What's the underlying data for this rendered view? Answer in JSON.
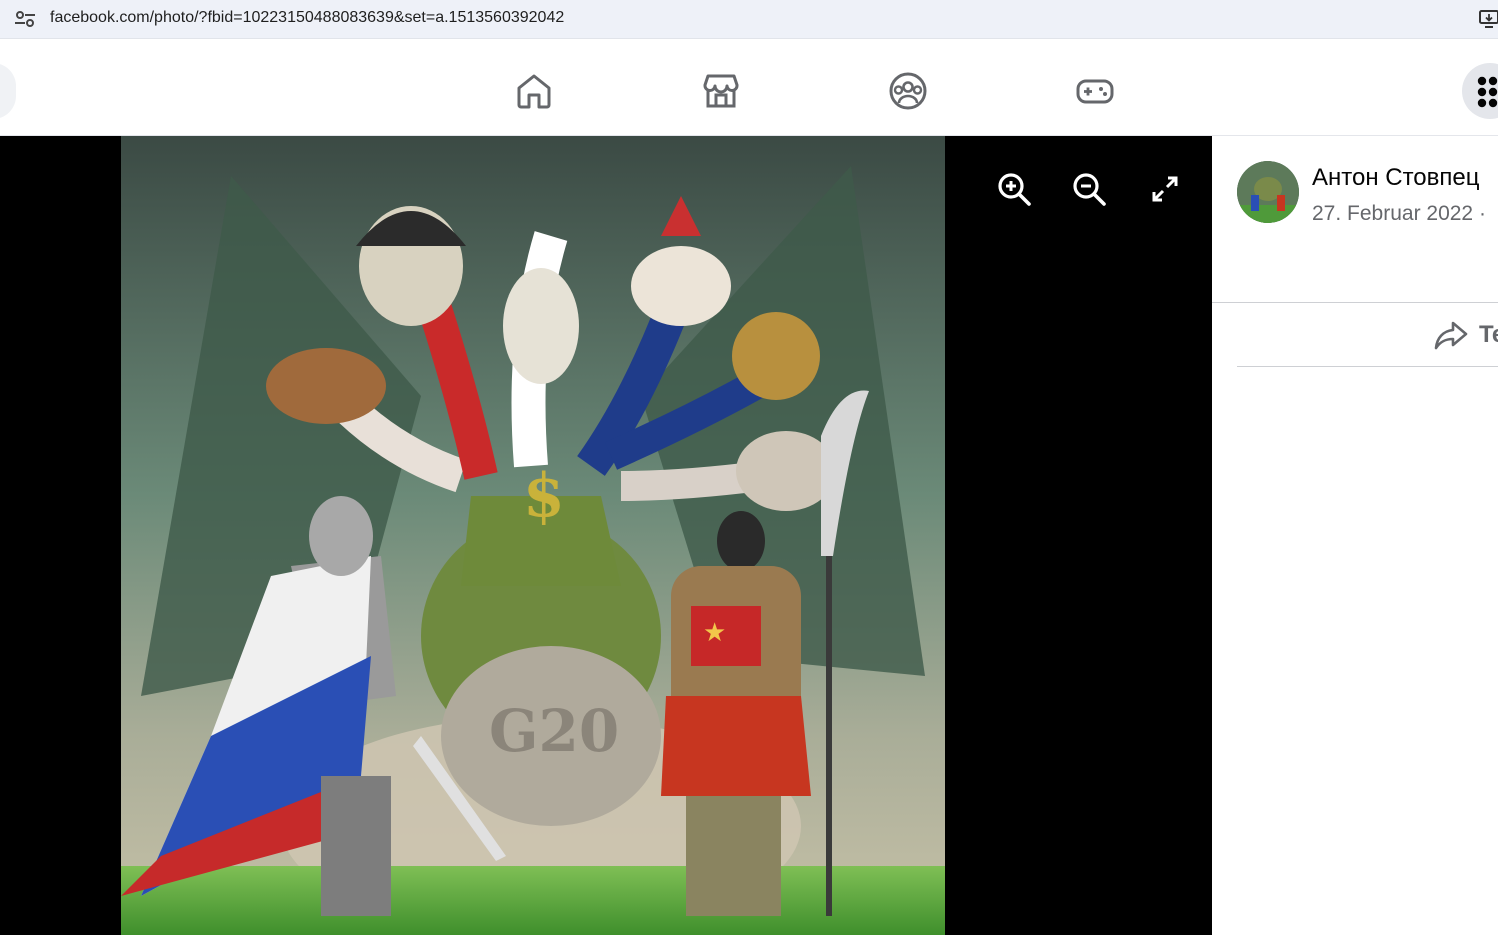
{
  "browser": {
    "url": "facebook.com/photo/?fbid=10223150488083639&set=a.1513560392042"
  },
  "nav": {
    "icons": [
      "home-icon",
      "marketplace-icon",
      "groups-icon",
      "gaming-icon",
      "menu-grid-icon"
    ]
  },
  "photo": {
    "caption_in_image": "G20",
    "tools": [
      "zoom-in-icon",
      "zoom-out-icon",
      "fullscreen-icon"
    ]
  },
  "post": {
    "author": "Антон Стовпец",
    "date": "27. Februar 2022 ·",
    "share_label": "Te"
  },
  "colors": {
    "viewer_bg": "#000000",
    "panel_bg": "#ffffff",
    "secondary_text": "#65676b",
    "address_bar": "#eef1f8"
  }
}
